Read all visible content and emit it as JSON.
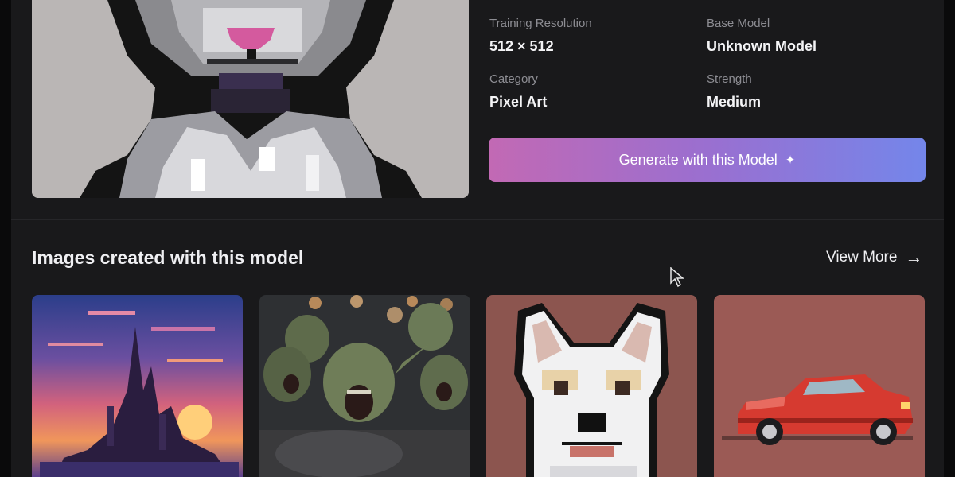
{
  "meta": [
    {
      "label": "Training Resolution",
      "value": "512 × 512"
    },
    {
      "label": "Base Model",
      "value": "Unknown Model"
    },
    {
      "label": "Category",
      "value": "Pixel Art"
    },
    {
      "label": "Strength",
      "value": "Medium"
    }
  ],
  "actions": {
    "generate_label": "Generate with this Model",
    "generate_icon": "sparkle-icon"
  },
  "gallery": {
    "title": "Images created with this model",
    "view_more_label": "View More",
    "view_more_icon": "arrow-right-icon",
    "images": [
      {
        "subject": "pixel castle at sunset",
        "icon": "castle-image"
      },
      {
        "subject": "goblins",
        "icon": "goblins-image"
      },
      {
        "subject": "pixel white dog",
        "icon": "dog-image"
      },
      {
        "subject": "pixel red car",
        "icon": "car-image"
      }
    ]
  },
  "colors": {
    "background": "#19191b",
    "button_gradient_start": "#c269b4",
    "button_gradient_end": "#7486ea"
  }
}
